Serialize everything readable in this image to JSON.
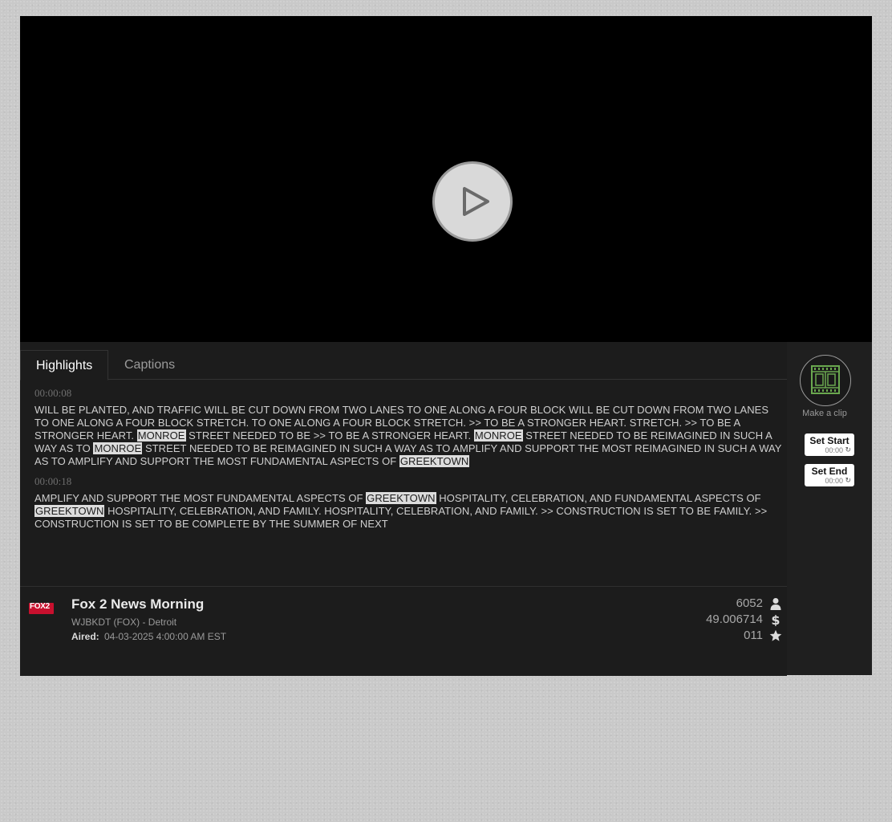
{
  "tabs": {
    "highlights": "Highlights",
    "captions": "Captions"
  },
  "captions": [
    {
      "time": "00:00:08",
      "segments": [
        {
          "text": "WILL BE PLANTED, AND TRAFFIC WILL BE CUT DOWN FROM TWO LANES TO ONE ALONG A FOUR BLOCK WILL BE CUT DOWN FROM TWO LANES TO ONE ALONG A FOUR BLOCK STRETCH. TO ONE ALONG A FOUR BLOCK STRETCH. >> TO BE A STRONGER HEART. STRETCH. >> TO BE A STRONGER HEART. ",
          "highlight": false
        },
        {
          "text": "MONROE",
          "highlight": true
        },
        {
          "text": " STREET NEEDED TO BE >> TO BE A STRONGER HEART. ",
          "highlight": false
        },
        {
          "text": "MONROE",
          "highlight": true
        },
        {
          "text": " STREET NEEDED TO BE REIMAGINED IN SUCH A WAY AS TO ",
          "highlight": false
        },
        {
          "text": "MONROE",
          "highlight": true
        },
        {
          "text": " STREET NEEDED TO BE REIMAGINED IN SUCH A WAY AS TO AMPLIFY AND SUPPORT THE MOST REIMAGINED IN SUCH A WAY AS TO AMPLIFY AND SUPPORT THE MOST FUNDAMENTAL ASPECTS OF ",
          "highlight": false
        },
        {
          "text": "GREEKTOWN",
          "highlight": true
        }
      ]
    },
    {
      "time": "00:00:18",
      "segments": [
        {
          "text": "AMPLIFY AND SUPPORT THE MOST FUNDAMENTAL ASPECTS OF ",
          "highlight": false
        },
        {
          "text": "GREEKTOWN",
          "highlight": true
        },
        {
          "text": " HOSPITALITY, CELEBRATION, AND FUNDAMENTAL ASPECTS OF ",
          "highlight": false
        },
        {
          "text": "GREEKTOWN",
          "highlight": true
        },
        {
          "text": " HOSPITALITY, CELEBRATION, AND FAMILY. HOSPITALITY, CELEBRATION, AND FAMILY. >> CONSTRUCTION IS SET TO BE FAMILY. >> CONSTRUCTION IS SET TO BE COMPLETE BY THE SUMMER OF NEXT",
          "highlight": false
        }
      ]
    }
  ],
  "program": {
    "logo_text": "FOX2",
    "title": "Fox 2 News Morning",
    "station": "WJBKDT (FOX) - Detroit",
    "aired_label": "Aired:",
    "aired_value": "04-03-2025 4:00:00 AM EST"
  },
  "stats": {
    "audience": "6052",
    "value": "49.006714",
    "rating": "011",
    "icons": [
      "person-icon",
      "dollar-icon",
      "star-icon"
    ]
  },
  "clip": {
    "make_label": "Make a clip",
    "set_start_label": "Set Start",
    "set_start_time": "00:00",
    "set_end_label": "Set End",
    "set_end_time": "00:00",
    "refresh_glyph": "↻"
  },
  "colors": {
    "highlight_bg": "#dcdcdc",
    "clip_icon": "#6aa84f",
    "logo_red": "#c8102e"
  }
}
